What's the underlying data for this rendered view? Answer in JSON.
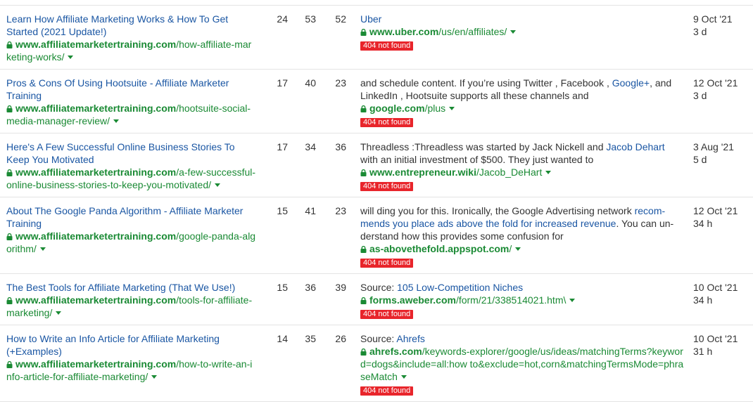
{
  "colors": {
    "title": "#1a56a3",
    "url": "#1a8a34",
    "badge": "#e8252b"
  },
  "rows": [
    {
      "title": "Learn How Affiliate Marketing Works & How To Get Started (2021 Update!)",
      "domain": "www.affiliatemarketertraining.com",
      "path": "/how-affiliate-marketing-works/",
      "n1": "24",
      "n2": "53",
      "n3": "52",
      "ref_pre": "",
      "ref_link": "Uber",
      "ref_post": "",
      "ref_domain": "www.uber.com",
      "ref_path": "/us/en/affiliates/",
      "badge": "404 not found",
      "date": "9 Oct '21",
      "age": "3 d"
    },
    {
      "title": "Pros & Cons Of Using Hootsuite - Affiliate Marketer Training",
      "domain": "www.affiliatemarketertraining.com",
      "path": "/hootsuite-social-media-manager-review/",
      "n1": "17",
      "n2": "40",
      "n3": "23",
      "ref_pre": "and schedule content. If you’re using Twitter , Facebook , ",
      "ref_link": "Google+",
      "ref_post": ", and LinkedIn , Hootsuite supports all these channels and",
      "ref_domain": "google.com",
      "ref_path": "/plus",
      "badge": "404 not found",
      "date": "12 Oct '21",
      "age": "3 d"
    },
    {
      "title": "Here's A Few Successful Online Business Stories To Keep You Motivated",
      "domain": "www.affiliatemarketertraining.com",
      "path": "/a-few-successful-online-business-stories-to-keep-you-motivated/",
      "n1": "17",
      "n2": "34",
      "n3": "36",
      "ref_pre": "Threadless :Threadless was started by Jack Nickell and ",
      "ref_link": "Jacob Dehart",
      "ref_post": " with an initial investment of $500. They just wanted to",
      "ref_domain": "www.entrepreneur.wiki",
      "ref_path": "/Jacob_DeHart",
      "badge": "404 not found",
      "date": "3 Aug '21",
      "age": "5 d"
    },
    {
      "title": "About The Google Panda Algorithm - Affiliate Marketer Training",
      "domain": "www.affiliatemarketertraining.com",
      "path": "/google-panda-algorithm/",
      "n1": "15",
      "n2": "41",
      "n3": "23",
      "ref_pre": "will ding you for this. Ironically, the Google Advertising network ",
      "ref_link": "recom-mends you place ads above the fold for increased revenue",
      "ref_post": ". You can un-derstand how this provides some confusion for",
      "ref_domain": "as-abovethefold.appspot.com",
      "ref_path": "/",
      "badge": "404 not found",
      "date": "12 Oct '21",
      "age": "34 h"
    },
    {
      "title": "The Best Tools for Affiliate Marketing (That We Use!)",
      "domain": "www.affiliatemarketertraining.com",
      "path": "/tools-for-affiliate-marketing/",
      "n1": "15",
      "n2": "36",
      "n3": "39",
      "ref_pre": "Source: ",
      "ref_link": "105 Low-Competition Niches",
      "ref_post": "",
      "ref_domain": "forms.aweber.com",
      "ref_path": "/form/21/338514021.htm\\",
      "badge": "404 not found",
      "date": "10 Oct '21",
      "age": "34 h"
    },
    {
      "title": "How to Write an Info Article for Affiliate Marketing (+Examples)",
      "domain": "www.affiliatemarketertraining.com",
      "path": "/how-to-write-an-info-article-for-affiliate-marketing/",
      "n1": "14",
      "n2": "35",
      "n3": "26",
      "ref_pre": "Source: ",
      "ref_link": "Ahrefs",
      "ref_post": "",
      "ref_domain": "ahrefs.com",
      "ref_path": "/keywords-explorer/google/us/ideas/matchingTerms?keyword=dogs&include=all:how to&exclude=hot,corn&matchingTermsMode=phraseMatch",
      "badge": "404 not found",
      "date": "10 Oct '21",
      "age": "31 h"
    }
  ]
}
